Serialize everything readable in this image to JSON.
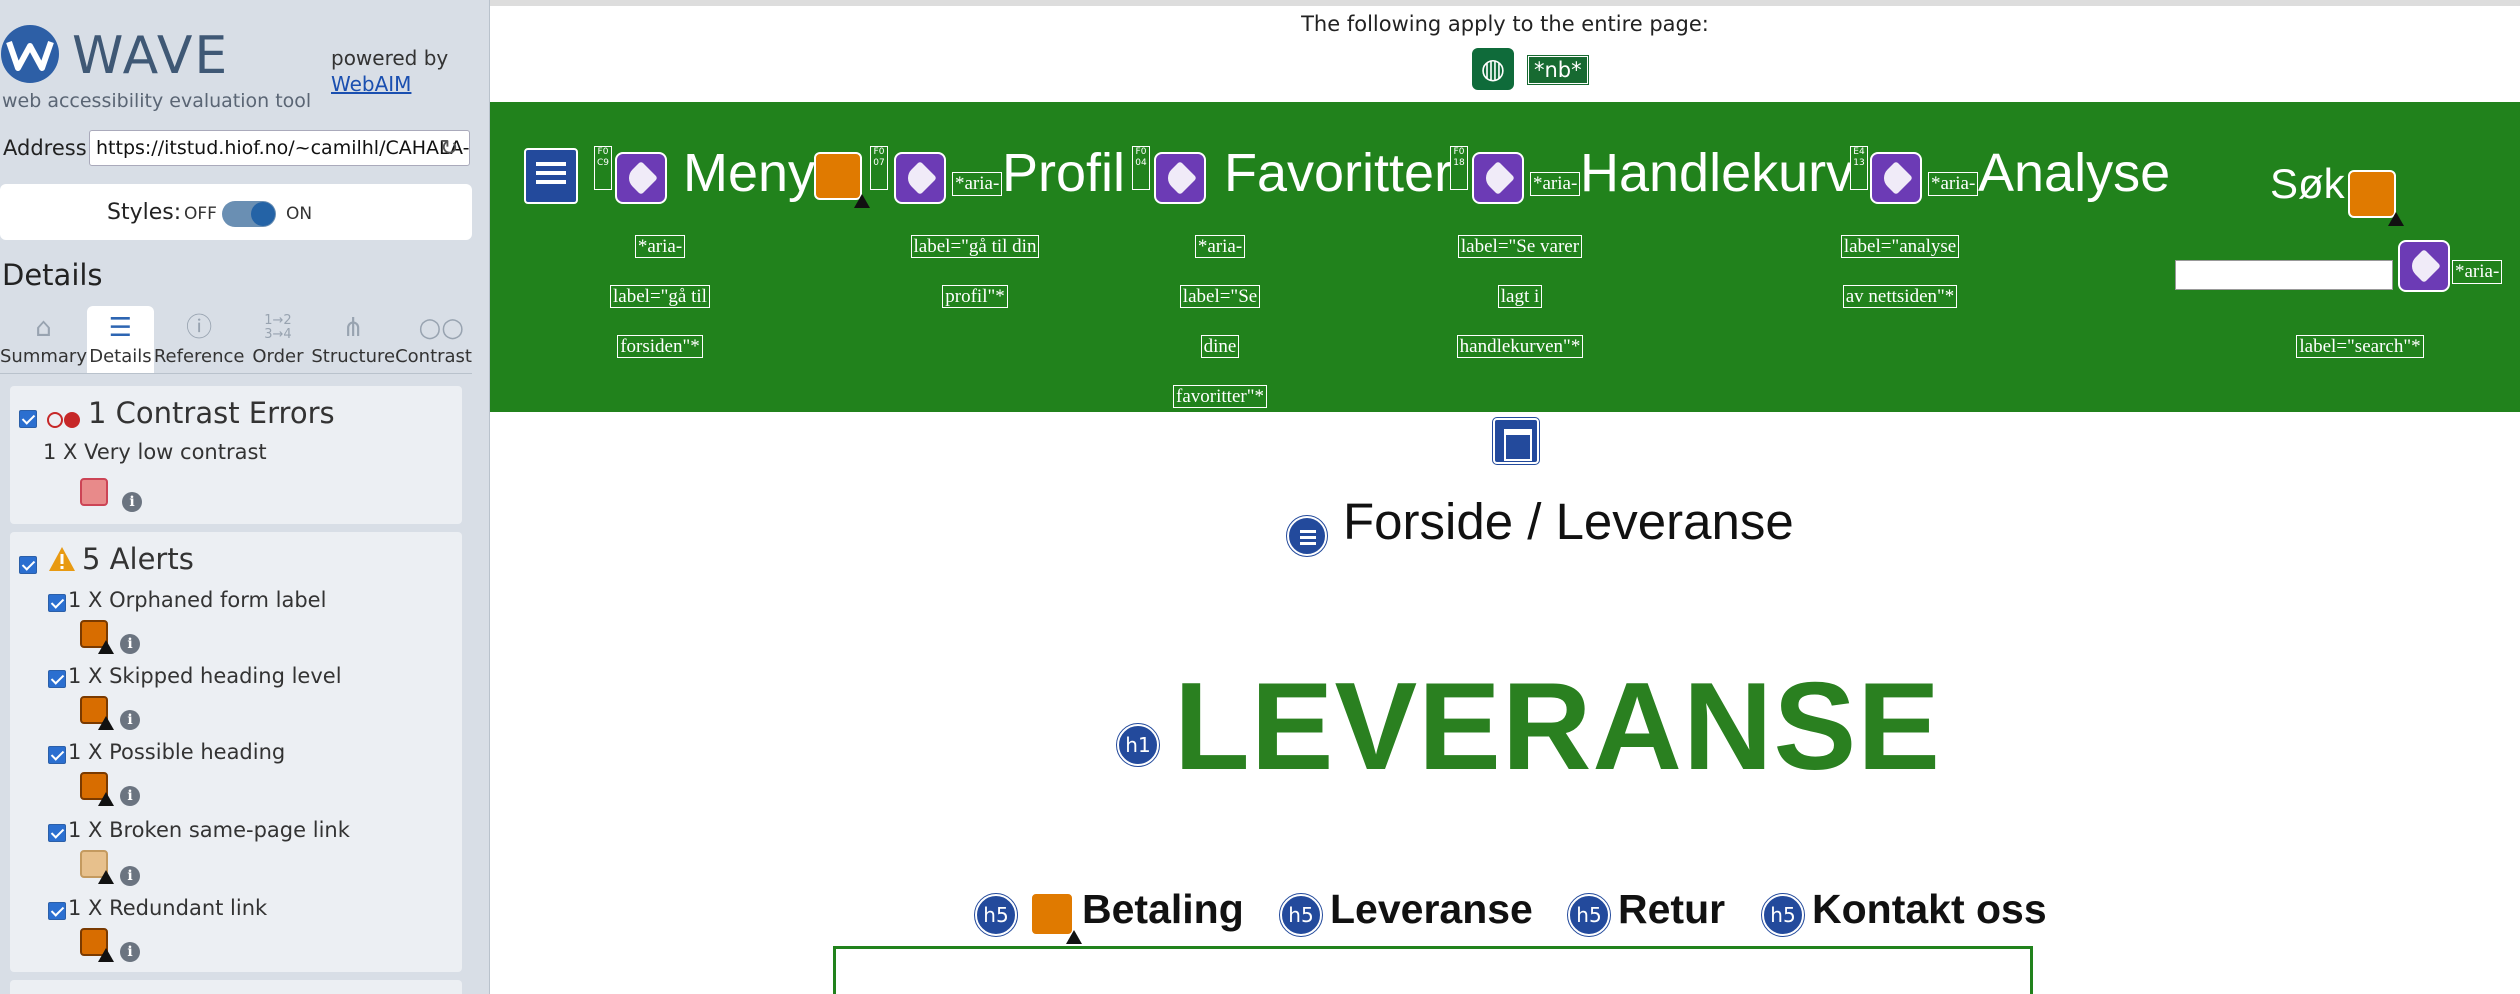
{
  "sidebar": {
    "logo_text": "WAVE",
    "subtitle": "web accessibility evaluation tool",
    "powered_by": "powered by",
    "webaim_link": "WebAIM",
    "address_label": "Address:",
    "address_value": "https://itstud.hiof.no/~camilhl/CAHALA-Sho",
    "styles_label": "Styles:",
    "styles_off": "OFF",
    "styles_on": "ON",
    "details_title": "Details",
    "tabs": [
      {
        "label": "Summary",
        "icon": "home-icon"
      },
      {
        "label": "Details",
        "icon": "list-icon"
      },
      {
        "label": "Reference",
        "icon": "info-icon"
      },
      {
        "label": "Order",
        "icon": "order-icon"
      },
      {
        "label": "Structure",
        "icon": "structure-icon"
      },
      {
        "label": "Contrast",
        "icon": "contrast-icon"
      }
    ],
    "contrast": {
      "title": "1 Contrast Errors",
      "items": [
        {
          "label": "1 X Very low contrast"
        }
      ]
    },
    "alerts": {
      "title": "5 Alerts",
      "items": [
        {
          "label": "1 X Orphaned form label"
        },
        {
          "label": "1 X Skipped heading level"
        },
        {
          "label": "1 X Possible heading"
        },
        {
          "label": "1 X Broken same-page link"
        },
        {
          "label": "1 X Redundant link"
        }
      ]
    }
  },
  "main": {
    "page_notice": "The following apply to the entire page:",
    "lang_tag": "*nb*",
    "nav": {
      "words": [
        "Meny",
        "Profil",
        "Favoritter",
        "Handlekurv",
        "Analyse",
        "Søk"
      ],
      "aria_short": "*aria-",
      "captions": {
        "meny": [
          "*aria-",
          "label=\"gå til",
          "forsiden\"*"
        ],
        "profil": [
          "label=\"gå til din",
          "profil\"*"
        ],
        "favoritter": [
          "*aria-",
          "label=\"Se",
          "dine",
          "favoritter\"*"
        ],
        "handlekurv": [
          "label=\"Se varer",
          "lagt i",
          "handlekurven\"*"
        ],
        "analyse": [
          "label=\"analyse",
          "av nettsiden\"*"
        ],
        "sok": [
          "label=\"search\"*"
        ]
      },
      "tabindex_labels": [
        "F0 C9",
        "F0 07",
        "F0 04",
        "F0 18",
        "E4 13"
      ]
    },
    "breadcrumb": "Forside /  Leveranse",
    "h1_badge": "h1",
    "heading": "LEVERANSE",
    "h5_badge": "h5",
    "h5_items": [
      "Betaling",
      "Leveranse",
      "Retur",
      "Kontakt oss"
    ]
  },
  "colors": {
    "nav_green": "#21821c",
    "heading_green": "#2a8020",
    "badge_blue": "#234a9c",
    "tag_purple": "#6c3bb5",
    "alert_orange": "#e07a00"
  }
}
